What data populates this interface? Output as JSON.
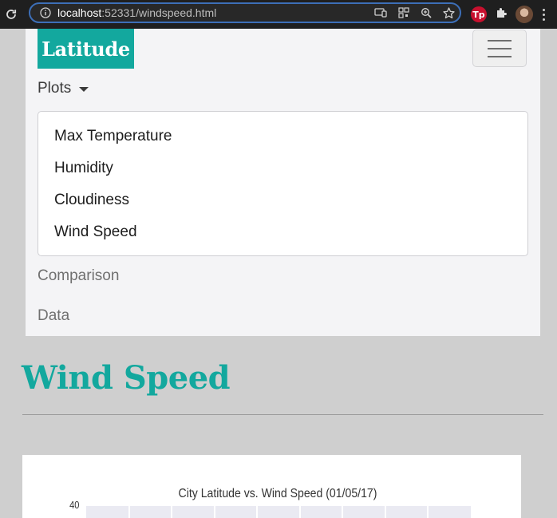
{
  "browser": {
    "url_host": "localhost",
    "url_rest": ":52331/windspeed.html",
    "extension_badge": "Tp"
  },
  "navbar": {
    "brand": "Latitude",
    "plots_label": "Plots",
    "plots_menu": [
      "Max Temperature",
      "Humidity",
      "Cloudiness",
      "Wind Speed"
    ],
    "comparison_label": "Comparison",
    "data_label": "Data"
  },
  "page": {
    "title": "Wind Speed"
  },
  "colors": {
    "accent": "#13a89e",
    "page_bg": "#cfcfcf",
    "navbar_bg": "#f4f4f6",
    "plot_bg": "#eaeaf2"
  },
  "chart_data": {
    "type": "scatter",
    "title": "City Latitude vs. Wind Speed (01/05/17)",
    "y_tick_labels": [
      "40"
    ],
    "grid": true
  }
}
